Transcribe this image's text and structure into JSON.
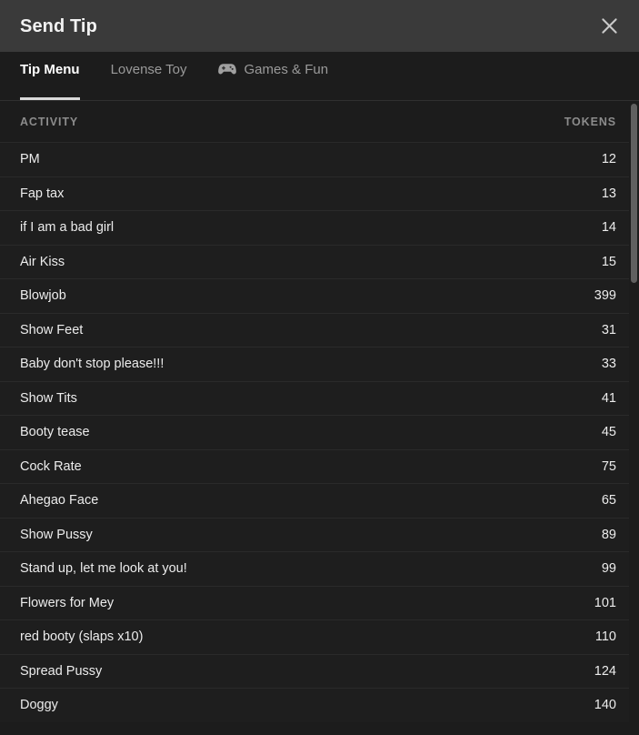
{
  "header": {
    "title": "Send Tip",
    "close_icon": "close-icon"
  },
  "tabs": [
    {
      "label": "Tip Menu",
      "active": true,
      "icon": null
    },
    {
      "label": "Lovense Toy",
      "active": false,
      "icon": null
    },
    {
      "label": "Games & Fun",
      "active": false,
      "icon": "gamepad-icon"
    }
  ],
  "table": {
    "columns": {
      "activity": "ACTIVITY",
      "tokens": "TOKENS"
    },
    "rows": [
      {
        "activity": "PM",
        "tokens": "12"
      },
      {
        "activity": "Fap tax",
        "tokens": "13"
      },
      {
        "activity": "if I am a bad girl",
        "tokens": "14"
      },
      {
        "activity": "Air Kiss",
        "tokens": "15"
      },
      {
        "activity": "Blowjob",
        "tokens": "399"
      },
      {
        "activity": "Show Feet",
        "tokens": "31"
      },
      {
        "activity": "Baby don't stop please!!!",
        "tokens": "33"
      },
      {
        "activity": "Show Tits",
        "tokens": "41"
      },
      {
        "activity": "Booty tease",
        "tokens": "45"
      },
      {
        "activity": "Cock Rate",
        "tokens": "75"
      },
      {
        "activity": "Ahegao Face",
        "tokens": "65"
      },
      {
        "activity": "Show Pussy",
        "tokens": "89"
      },
      {
        "activity": "Stand up, let me look at you!",
        "tokens": "99"
      },
      {
        "activity": "Flowers for Mey",
        "tokens": "101"
      },
      {
        "activity": "red booty (slaps x10)",
        "tokens": "110"
      },
      {
        "activity": "Spread Pussy",
        "tokens": "124"
      },
      {
        "activity": "Doggy",
        "tokens": "140"
      }
    ]
  },
  "colors": {
    "header_bg": "#3a3a3a",
    "body_bg": "#1c1c1c",
    "row_bg": "#1e1e1e",
    "row_divider": "#2a2a2a",
    "text_primary": "#ececec",
    "text_muted": "#9a9a9a",
    "tab_active_underline": "#d8d8d8",
    "scrollbar_thumb": "#606060"
  }
}
